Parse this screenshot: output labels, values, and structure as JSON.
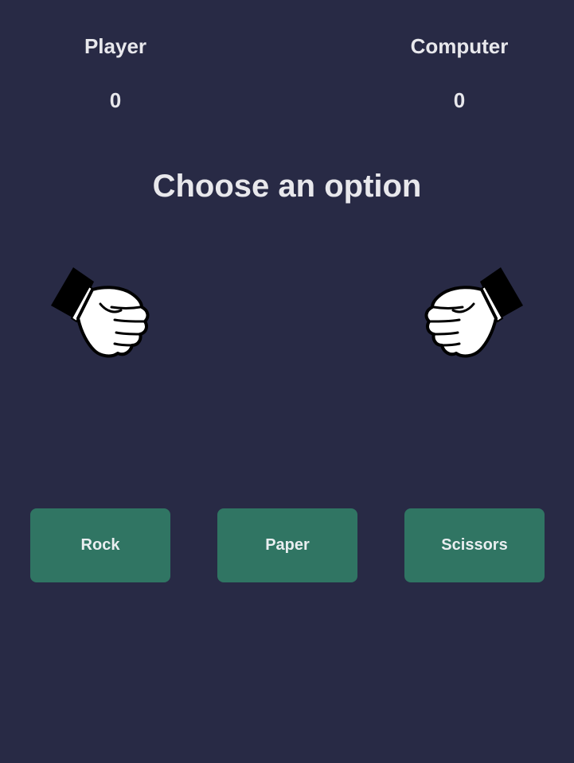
{
  "scoreboard": {
    "player": {
      "label": "Player",
      "score": "0"
    },
    "computer": {
      "label": "Computer",
      "score": "0"
    }
  },
  "message": "Choose an option",
  "hands": {
    "player": "fist-icon",
    "computer": "fist-icon"
  },
  "choices": [
    {
      "label": "Rock"
    },
    {
      "label": "Paper"
    },
    {
      "label": "Scissors"
    }
  ],
  "colors": {
    "background": "#282a45",
    "button": "#307563",
    "text": "#e8e8ec"
  }
}
